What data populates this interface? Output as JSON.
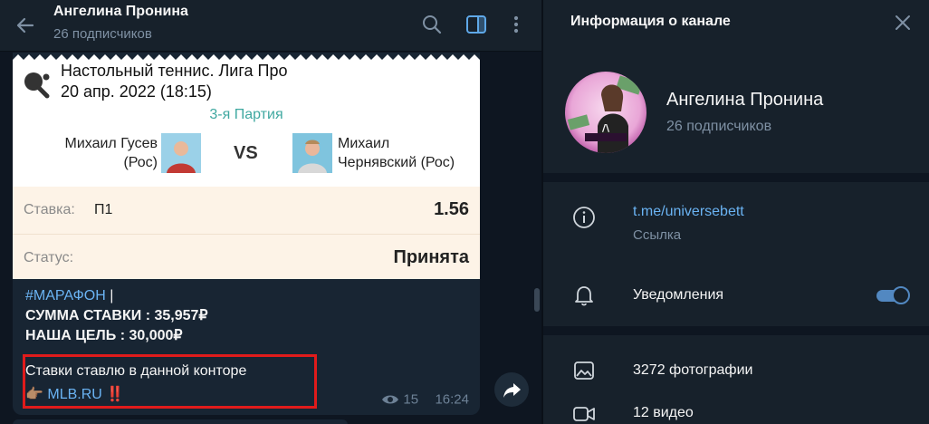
{
  "chat": {
    "title": "Ангелина Пронина",
    "subtitle": "26 подписчиков"
  },
  "card": {
    "event_title": "Настольный теннис. Лига Про",
    "event_date": "20 апр. 2022 (18:15)",
    "part": "3-я Партия",
    "player1_line1": "Михаил Гусев",
    "player1_line2": "(Рос)",
    "vs": "VS",
    "player2_line1": "Михаил",
    "player2_line2": "Чернявский (Рос)",
    "bet_label": "Ставка:",
    "bet_value": "П1",
    "odds": "1.56",
    "status_label": "Статус:",
    "status_value": "Принята"
  },
  "message": {
    "hashtag": "#МАРАФОН",
    "separator": " |",
    "line_sum": "СУММА СТАВКИ : 35,957₽",
    "line_goal": "НАША ЦЕЛЬ : 30,000₽",
    "highlight_text": "Ставки ставлю в данной конторе",
    "pointer_emoji": "👉🏽",
    "link_text": "MLB.RU",
    "exclaim": "‼️",
    "views": "15",
    "time": "16:24"
  },
  "info_panel": {
    "title": "Информация о канале",
    "channel_name": "Ангелина Пронина",
    "subscribers": "26 подписчиков",
    "link": "t.me/universebett",
    "link_label": "Ссылка",
    "notifications_label": "Уведомления",
    "notifications_on": true,
    "photos": "3272 фотографии",
    "videos": "12 видео"
  },
  "colors": {
    "accent": "#6ab3f3",
    "toggle": "#5288c1",
    "highlight_border": "#e01b1b",
    "part_text": "#3fa8a0"
  }
}
